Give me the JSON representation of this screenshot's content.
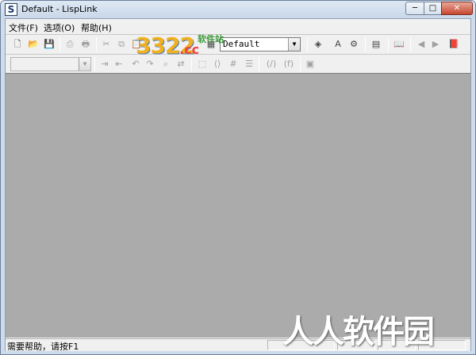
{
  "window": {
    "title": "Default - LispLink",
    "app_icon": "lisplink-app-icon",
    "buttons": {
      "minimize": "─",
      "maximize": "□",
      "close": "✕"
    }
  },
  "menubar": {
    "items": [
      {
        "label": "文件(F)"
      },
      {
        "label": "选项(O)"
      },
      {
        "label": "帮助(H)"
      }
    ]
  },
  "toolbar1": {
    "new_icon": "new-file-icon",
    "open_icon": "open-folder-icon",
    "save_icon": "save-icon",
    "profile_combo_value": "Default"
  },
  "toolbar2": {
    "combo_value": "",
    "paren_label": "(/)",
    "func_label": "(f)"
  },
  "statusbar": {
    "text": "需要帮助，请按F1"
  },
  "watermarks": {
    "logo": "3322",
    "logo_suffix": ".cc",
    "logo_soft": "软件站",
    "big": "人人软件园"
  },
  "colors": {
    "workspace": "#ababab",
    "titlebar": "#dfe9f5",
    "close_button": "#c7462f"
  }
}
